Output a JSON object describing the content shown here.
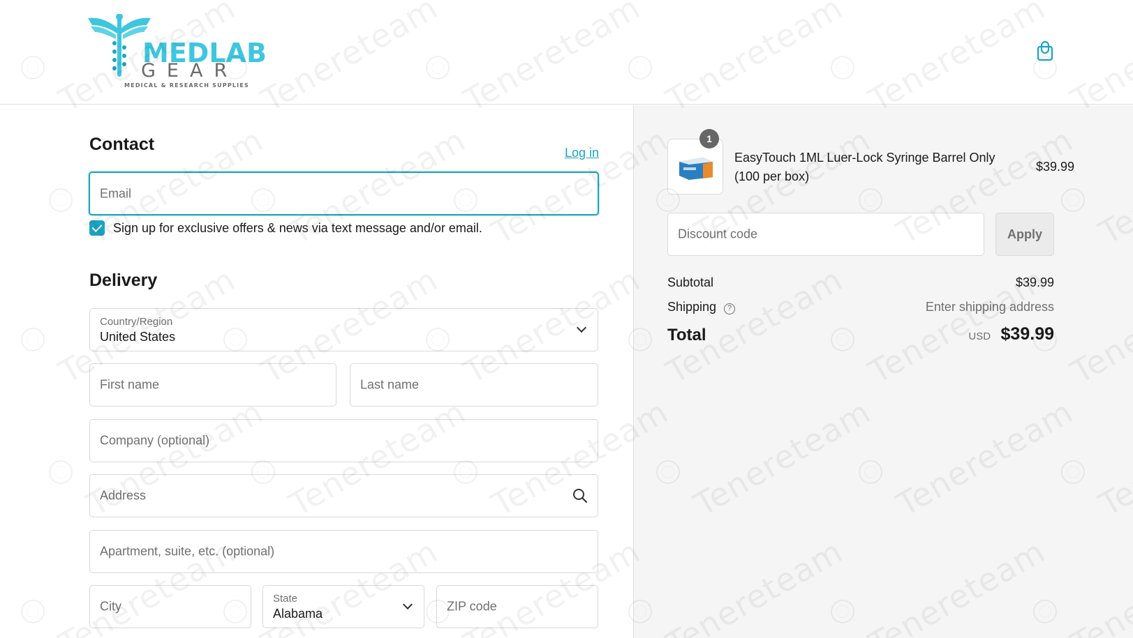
{
  "header": {
    "logo": {
      "word1": "MEDLAB",
      "word2": "GEAR",
      "tagline": "MEDICAL & RESEARCH SUPPLIES"
    },
    "cart_icon": "shopping-bag-icon"
  },
  "contact": {
    "title": "Contact",
    "login_label": "Log in",
    "email_placeholder": "Email",
    "marketing_optin_checked": true,
    "marketing_optin_label": "Sign up for exclusive offers & news via text message and/or email."
  },
  "delivery": {
    "title": "Delivery",
    "country": {
      "label": "Country/Region",
      "value": "United States"
    },
    "first_name_placeholder": "First name",
    "last_name_placeholder": "Last name",
    "company_placeholder": "Company (optional)",
    "address_placeholder": "Address",
    "apartment_placeholder": "Apartment, suite, etc. (optional)",
    "city_placeholder": "City",
    "state": {
      "label": "State",
      "value": "Alabama"
    },
    "zip_placeholder": "ZIP code"
  },
  "summary": {
    "item": {
      "quantity": "1",
      "name": "EasyTouch 1ML Luer-Lock Syringe Barrel Only (100 per box)",
      "price": "$39.99"
    },
    "discount_placeholder": "Discount code",
    "apply_label": "Apply",
    "subtotal_label": "Subtotal",
    "subtotal_value": "$39.99",
    "shipping_label": "Shipping",
    "shipping_value": "Enter shipping address",
    "total_label": "Total",
    "currency": "USD",
    "total_value": "$39.99"
  },
  "watermark": "Tenereteam",
  "colors": {
    "accent": "#1ba4c4",
    "logo_blue": "#3ec6df",
    "summary_bg": "#f5f5f5"
  }
}
